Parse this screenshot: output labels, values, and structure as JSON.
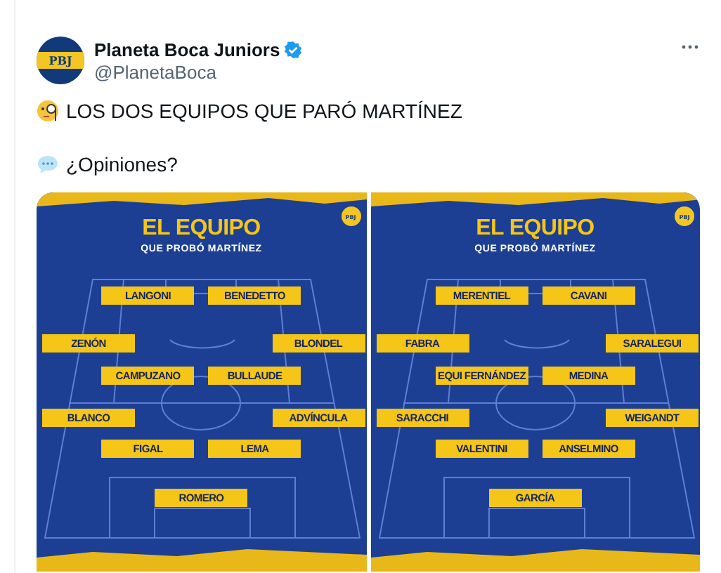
{
  "post": {
    "avatar_text": "PBJ",
    "author": "Planeta Boca Juniors",
    "verified": true,
    "handle": "@PlanetaBoca",
    "lines": [
      "LOS DOS EQUIPOS QUE PARÓ MARTÍNEZ",
      "¿Opiniones?"
    ]
  },
  "graphics": [
    {
      "title": "EL EQUIPO",
      "subtitle": "QUE PROBÓ MARTÍNEZ",
      "badge": "PBJ",
      "rows": [
        {
          "kind": "inner",
          "players": [
            "LANGONI",
            "BENEDETTO"
          ]
        },
        {
          "kind": "outer",
          "players": [
            "ZENÓN",
            "BLONDEL"
          ]
        },
        {
          "kind": "inner",
          "players": [
            "CAMPUZANO",
            "BULLAUDE"
          ]
        },
        {
          "kind": "outer",
          "players": [
            "BLANCO",
            "ADVÍNCULA"
          ]
        },
        {
          "kind": "inner",
          "players": [
            "FIGAL",
            "LEMA"
          ]
        },
        {
          "kind": "inner",
          "players": [
            "ROMERO"
          ]
        }
      ]
    },
    {
      "title": "EL EQUIPO",
      "subtitle": "QUE PROBÓ MARTÍNEZ",
      "badge": "PBJ",
      "rows": [
        {
          "kind": "inner",
          "players": [
            "MERENTIEL",
            "CAVANI"
          ]
        },
        {
          "kind": "outer",
          "players": [
            "FABRA",
            "SARALEGUI"
          ]
        },
        {
          "kind": "inner",
          "players": [
            "EQUI FERNÁNDEZ",
            "MEDINA"
          ]
        },
        {
          "kind": "outer",
          "players": [
            "SARACCHI",
            "WEIGANDT"
          ]
        },
        {
          "kind": "inner",
          "players": [
            "VALENTINI",
            "ANSELMINO"
          ]
        },
        {
          "kind": "inner",
          "players": [
            "GARCÍA"
          ]
        }
      ]
    }
  ]
}
